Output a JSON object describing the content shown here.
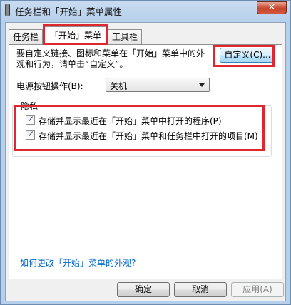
{
  "window": {
    "title": "任务栏和「开始」菜单属性",
    "close_glyph": "✕"
  },
  "tabs": [
    {
      "label": "任务栏",
      "active": false
    },
    {
      "label": "「开始」菜单",
      "active": true
    },
    {
      "label": "工具栏",
      "active": false
    }
  ],
  "start_menu": {
    "description": "要自定义链接、图标和菜单在「开始」菜单中的外观和行为，请单击“自定义”。",
    "customize_button": "自定义(C)...",
    "power_label": "电源按钮操作(B):",
    "power_value": "关机",
    "privacy": {
      "title": "隐私",
      "options": [
        {
          "label": "存储并显示最近在「开始」菜单中打开的程序(P)",
          "checked": true
        },
        {
          "label": "存储并显示最近在「开始」菜单和任务栏中打开的项目(M)",
          "checked": true
        }
      ]
    },
    "help_link": "如何更改「开始」菜单的外观?"
  },
  "buttons": {
    "ok": "确定",
    "cancel": "取消",
    "apply": "应用(A)"
  },
  "colors": {
    "highlight": "#e0262e",
    "link": "#0066cc",
    "close_button": "#c7452b"
  },
  "icons": {
    "window_icon": "taskbar-properties-icon",
    "dropdown": "chevron-down-icon",
    "check": "checkmark-icon"
  }
}
